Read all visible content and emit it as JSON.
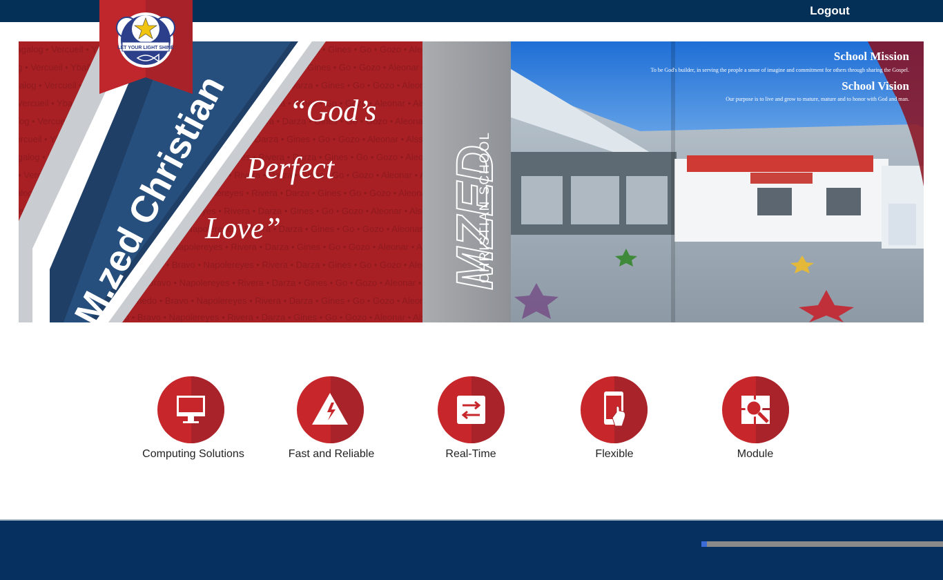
{
  "header": {
    "logout_label": "Logout",
    "bg_color": "#042f57"
  },
  "logo": {
    "stars_text": "ZACS M",
    "motto": "LET YOUR LIGHT SHINE",
    "year": "1997"
  },
  "banner": {
    "school_name": "M.zed Christian",
    "quote_line1": "“God’s",
    "quote_line2": "Perfect",
    "quote_line3": "Love”",
    "vertical_brand": "MZED",
    "vertical_sub": "CHRISTIAN SCHOOL",
    "mission_title": "School Mission",
    "mission_text": "To be God's builder, in serving the people a sense of imagine and commitment for others through sharing the Gospel.",
    "vision_title": "School Vision",
    "vision_text": "Our purpose is to live and grow to mature, mature and to honor with God and man.",
    "background_names": "Tagalog • Vercueil • Ybañez • Bernedo • Bravo • Napolereyes • Rivera • Darza • Gines • Go • Gozo • Aleonar • Alsso • Alvarez • Mabunay • Medalla • Monsanto • Nam • Lao • Koshy • Sarmiento • Rotaquio • Besañez • Ahn • ChuKeon"
  },
  "features": [
    {
      "label": "Computing Solutions",
      "icon": "monitor-icon"
    },
    {
      "label": "Fast and Reliable",
      "icon": "lightning-icon"
    },
    {
      "label": "Real-Time",
      "icon": "transfer-arrows-icon"
    },
    {
      "label": "Flexible",
      "icon": "mobile-touch-icon"
    },
    {
      "label": "Module",
      "icon": "module-search-icon"
    }
  ],
  "colors": {
    "accent_red": "#c7262b",
    "navy": "#063060"
  }
}
